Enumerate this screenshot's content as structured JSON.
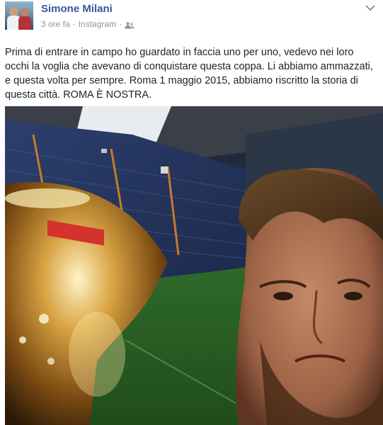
{
  "post": {
    "author": "Simone Milani",
    "timestamp": "3 ore fa",
    "separator": "·",
    "source": "Instagram",
    "audience_icon": "friends-icon",
    "menu_icon": "chevron-down-icon",
    "text": "Prima di entrare in campo ho guardato in faccia uno per uno, vedevo nei loro occhi la voglia che avevano di conquistare questa coppa. Li abbiamo ammazzati, e questa volta per sempre. Roma 1 maggio 2015, abbiamo riscritto la storia di questa città. ROMA È NOSTRA.",
    "link_color": "#365899",
    "meta_color": "#90949c"
  }
}
